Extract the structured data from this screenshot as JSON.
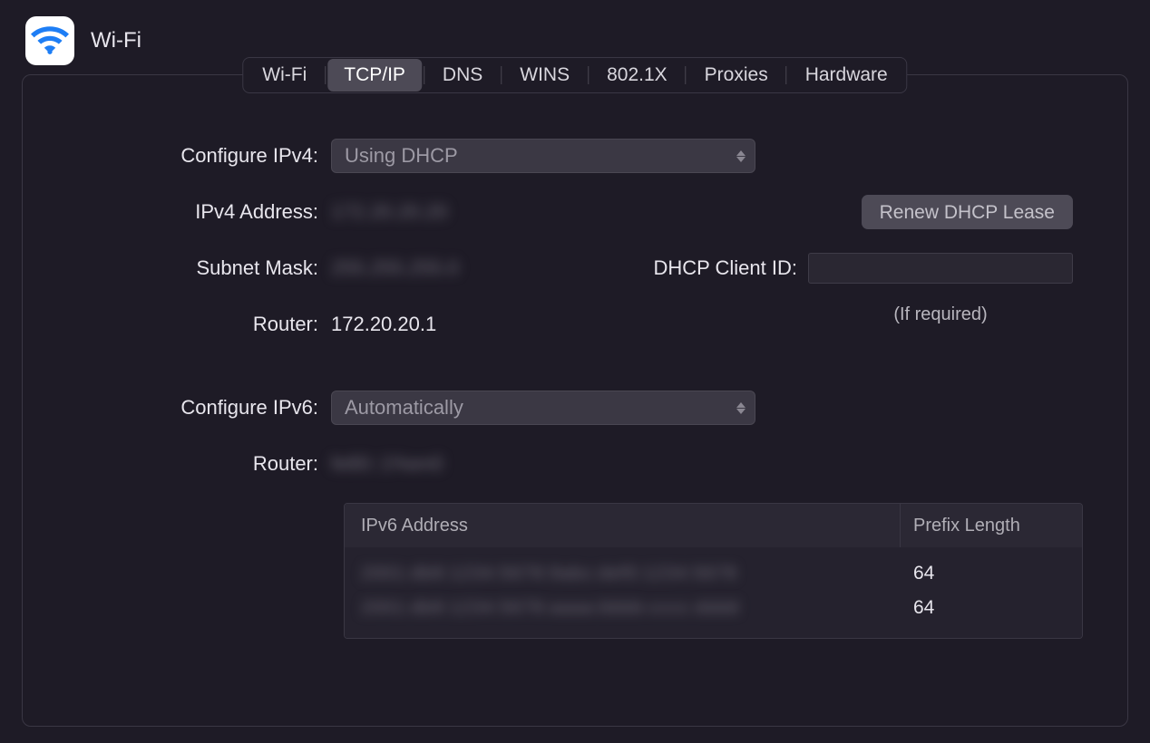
{
  "header": {
    "title": "Wi-Fi"
  },
  "tabs": [
    {
      "label": "Wi-Fi",
      "active": false
    },
    {
      "label": "TCP/IP",
      "active": true
    },
    {
      "label": "DNS",
      "active": false
    },
    {
      "label": "WINS",
      "active": false
    },
    {
      "label": "802.1X",
      "active": false
    },
    {
      "label": "Proxies",
      "active": false
    },
    {
      "label": "Hardware",
      "active": false
    }
  ],
  "ipv4": {
    "configure_label": "Configure IPv4:",
    "configure_value": "Using DHCP",
    "address_label": "IPv4 Address:",
    "address_value": "172.20.20.20",
    "subnet_label": "Subnet Mask:",
    "subnet_value": "255.255.255.0",
    "router_label": "Router:",
    "router_value": "172.20.20.1",
    "renew_button": "Renew DHCP Lease",
    "dhcp_client_label": "DHCP Client ID:",
    "dhcp_client_value": "",
    "dhcp_client_hint": "(If required)"
  },
  "ipv6": {
    "configure_label": "Configure IPv6:",
    "configure_value": "Automatically",
    "router_label": "Router:",
    "router_value": "fe80::1%en0",
    "table_headers": {
      "address": "IPv6 Address",
      "prefix": "Prefix Length"
    },
    "table_rows": [
      {
        "address": "2001:db8:1234:5678:9abc:def0:1234:5678",
        "prefix": "64"
      },
      {
        "address": "2001:db8:1234:5678:aaaa:bbbb:cccc:dddd",
        "prefix": "64"
      }
    ]
  }
}
